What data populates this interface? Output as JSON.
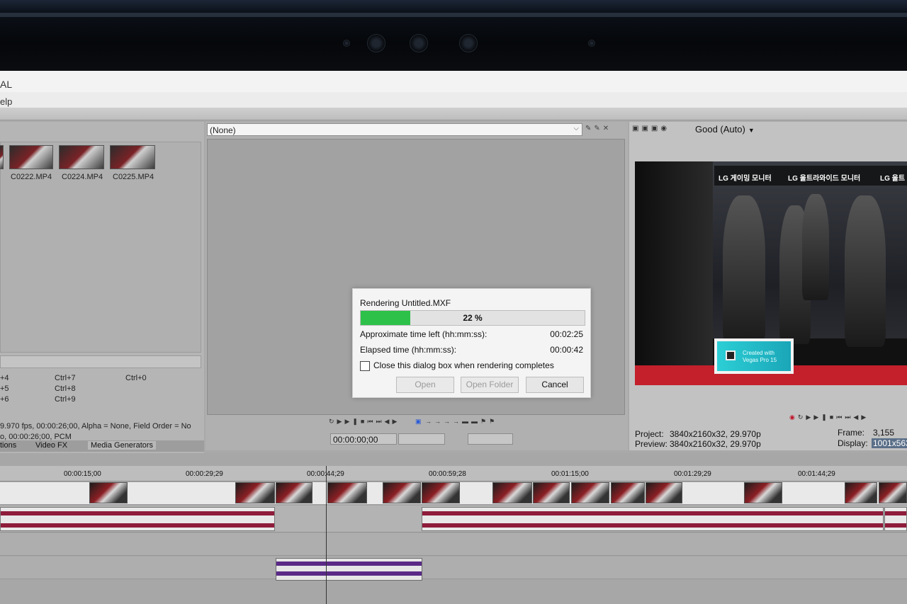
{
  "window": {
    "title_fragment": "AL",
    "menu_fragment": "elp"
  },
  "media_panel": {
    "thumbnails": [
      "C0222.MP4",
      "C0224.MP4",
      "C0225.MP4"
    ],
    "shortcuts": [
      [
        "+4",
        "Ctrl+7",
        "Ctrl+0"
      ],
      [
        "+5",
        "Ctrl+8",
        ""
      ],
      [
        "+6",
        "Ctrl+9",
        ""
      ]
    ],
    "info_line1": "9.970 fps, 00:00:26;00, Alpha = None, Field Order = No",
    "info_line2": "o, 00:00:26;00, PCM",
    "tabs": [
      "tions",
      "Video FX",
      "Media Generators"
    ]
  },
  "trimmer": {
    "selector_value": "(None)",
    "timecode": "00:00:00;00"
  },
  "render_dialog": {
    "title": "Rendering Untitled.MXF",
    "progress": 0.22,
    "progress_label": "22 %",
    "time_left_label": "Approximate time left (hh:mm:ss):",
    "time_left_value": "00:02:25",
    "elapsed_label": "Elapsed time (hh:mm:ss):",
    "elapsed_value": "00:00:42",
    "checkbox_label": "Close this dialog box when rendering completes",
    "checkbox_checked": false,
    "buttons": {
      "open": "Open",
      "open_folder": "Open Folder",
      "cancel": "Cancel"
    },
    "accent_color": "#2ec14a"
  },
  "preview": {
    "quality": "Good (Auto)",
    "frame_text": {
      "sign1": "LG 게이밍 모니터",
      "sign2": "LG 울트라와이드 모니터",
      "sign3": "LG 울트",
      "logo_fragment": "L",
      "watermark_line1": "Created with",
      "watermark_line2": "Vegas Pro 15"
    },
    "project_label": "Project:",
    "project_value": "3840x2160x32, 29.970p",
    "preview_label": "Preview:",
    "preview_value": "3840x2160x32, 29.970p",
    "frame_label": "Frame:",
    "frame_value": "3,155",
    "display_label": "Display:",
    "display_value": "1001x563"
  },
  "timeline": {
    "ruler": [
      "00:00:15;00",
      "00:00:29;29",
      "00:00:44;29",
      "00:00:59;28",
      "00:01:15;00",
      "00:01:29;29",
      "00:01:44;29"
    ]
  }
}
